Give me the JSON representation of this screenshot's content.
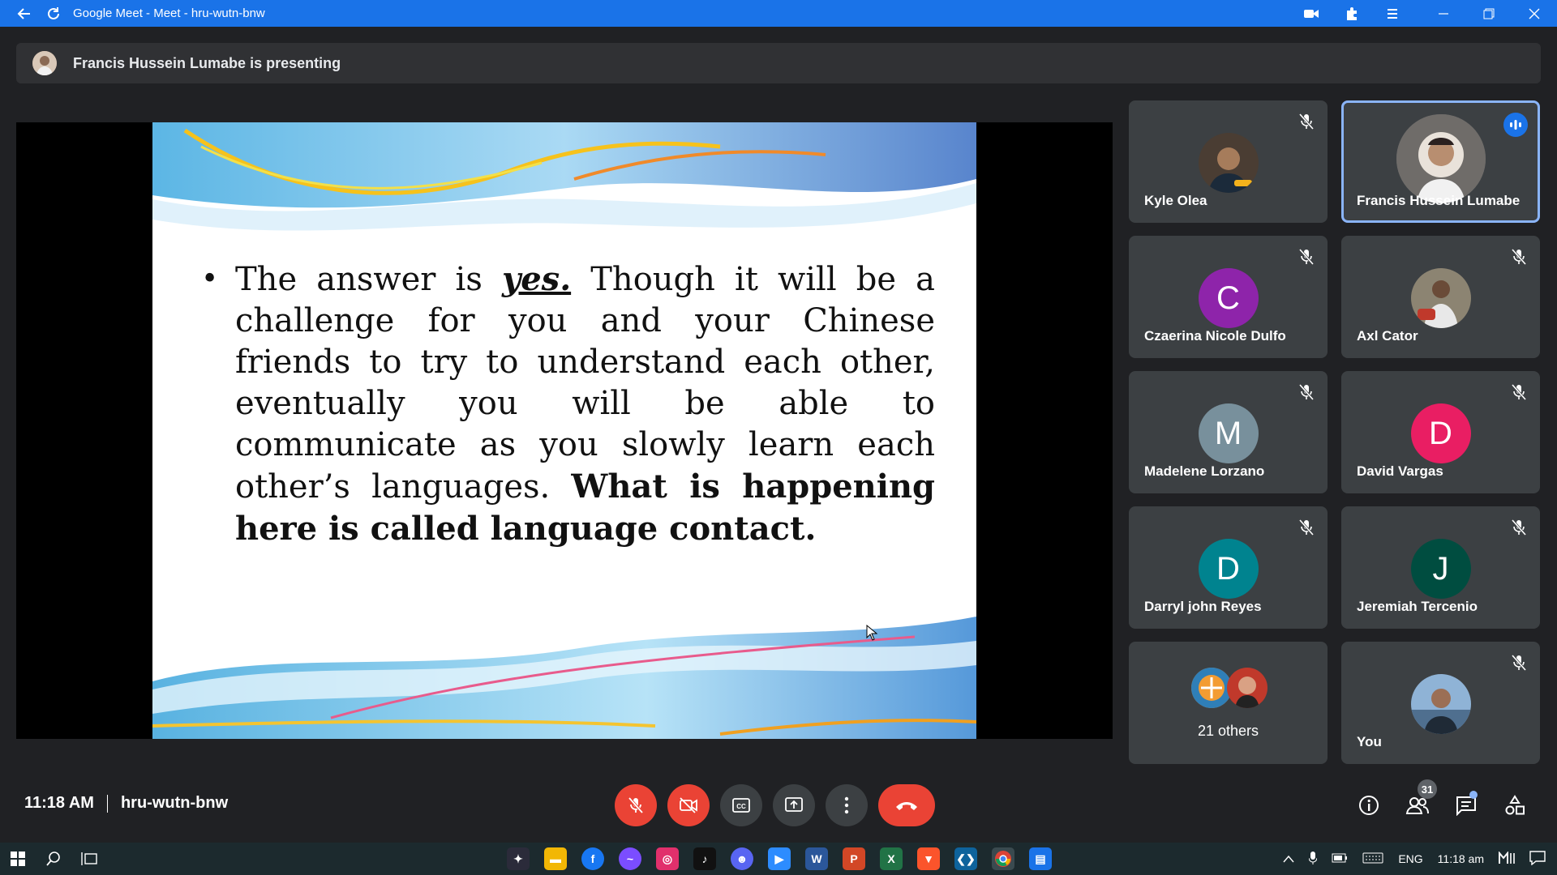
{
  "browser": {
    "title": "Google Meet - Meet - hru-wutn-bnw"
  },
  "presenting": {
    "text": "Francis Hussein Lumabe is presenting"
  },
  "slide": {
    "before_yes": "The answer is ",
    "yes": "yes.",
    "after_yes": " Though it will be a challenge for you and your Chinese friends to try to understand each other, eventually you will be able to communicate as you slowly learn each other’s languages. ",
    "emphasis": "What is happening here is called language contact."
  },
  "participants": [
    {
      "name": "Kyle Olea",
      "muted": true,
      "avatar_type": "photo",
      "color": "#6b5a4a"
    },
    {
      "name": "Francis Hussein Lumabe",
      "muted": false,
      "speaking": true,
      "avatar_type": "photo",
      "color": "#b98f72"
    },
    {
      "name": "Czaerina Nicole Dulfo",
      "initial": "C",
      "muted": true,
      "color": "#8e24aa"
    },
    {
      "name": "Axl Cator",
      "muted": true,
      "avatar_type": "photo",
      "color": "#9a8a75"
    },
    {
      "name": "Madelene Lorzano",
      "initial": "M",
      "muted": true,
      "color": "#78909c"
    },
    {
      "name": "David Vargas",
      "initial": "D",
      "muted": true,
      "color": "#e91e63"
    },
    {
      "name": "Darryl john Reyes",
      "initial": "D",
      "muted": true,
      "color": "#00838f"
    },
    {
      "name": "Jeremiah Tercenio",
      "initial": "J",
      "muted": true,
      "color": "#004d40"
    },
    {
      "name": "21 others",
      "type": "others"
    },
    {
      "name": "You",
      "muted": true,
      "avatar_type": "photo",
      "color": "#5b7fa6"
    }
  ],
  "meeting": {
    "time": "11:18 AM",
    "code": "hru-wutn-bnw",
    "people_count": "31"
  },
  "taskbar": {
    "lang": "ENG",
    "clock": "11:18 am"
  }
}
